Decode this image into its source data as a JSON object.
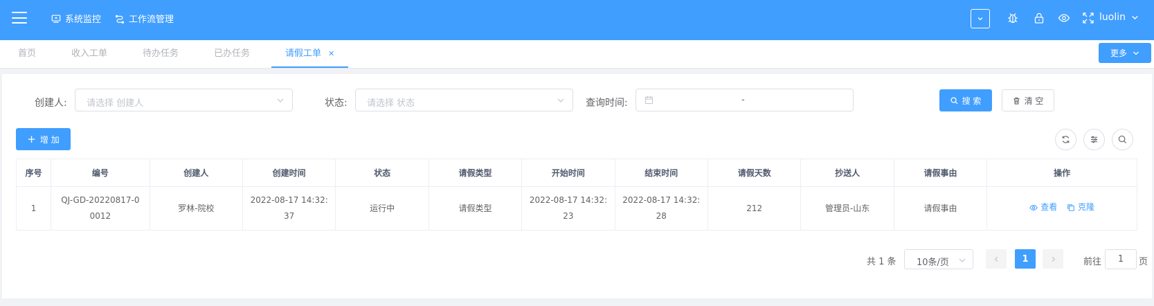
{
  "header": {
    "nav": [
      {
        "label": "系统监控",
        "icon": "monitor-icon"
      },
      {
        "label": "工作流管理",
        "icon": "workflow-icon"
      }
    ],
    "user": "luolin"
  },
  "tabs": [
    {
      "label": "首页"
    },
    {
      "label": "收入工单"
    },
    {
      "label": "待办任务"
    },
    {
      "label": "已办任务"
    },
    {
      "label": "请假工单",
      "active": true
    }
  ],
  "more_label": "更多",
  "filters": {
    "creator_label": "创建人:",
    "creator_placeholder": "请选择 创建人",
    "status_label": "状态:",
    "status_placeholder": "请选择 状态",
    "time_label": "查询时间:",
    "time_separator": "-"
  },
  "buttons": {
    "search": "搜 索",
    "clear": "清 空",
    "add": "增 加"
  },
  "table": {
    "columns": [
      "序号",
      "编号",
      "创建人",
      "创建时间",
      "状态",
      "请假类型",
      "开始时间",
      "结束时间",
      "请假天数",
      "抄送人",
      "请假事由",
      "操作"
    ],
    "rows": [
      {
        "index": "1",
        "code": "QJ-GD-20220817-0 0012",
        "creator": "罗林-院校",
        "created": "2022-08-17 14:32: 37",
        "status": "运行中",
        "leave_type": "请假类型",
        "start": "2022-08-17 14:32: 23",
        "end": "2022-08-17 14:32: 28",
        "days": "212",
        "cc": "管理员-山东",
        "reason": "请假事由",
        "view": "查看",
        "clone": "克隆"
      }
    ]
  },
  "pagination": {
    "total": "共 1 条",
    "page_size": "10条/页",
    "current": "1",
    "goto_label": "前往",
    "goto_value": "1",
    "page_suffix": "页"
  },
  "colors": {
    "primary": "#409eff"
  }
}
